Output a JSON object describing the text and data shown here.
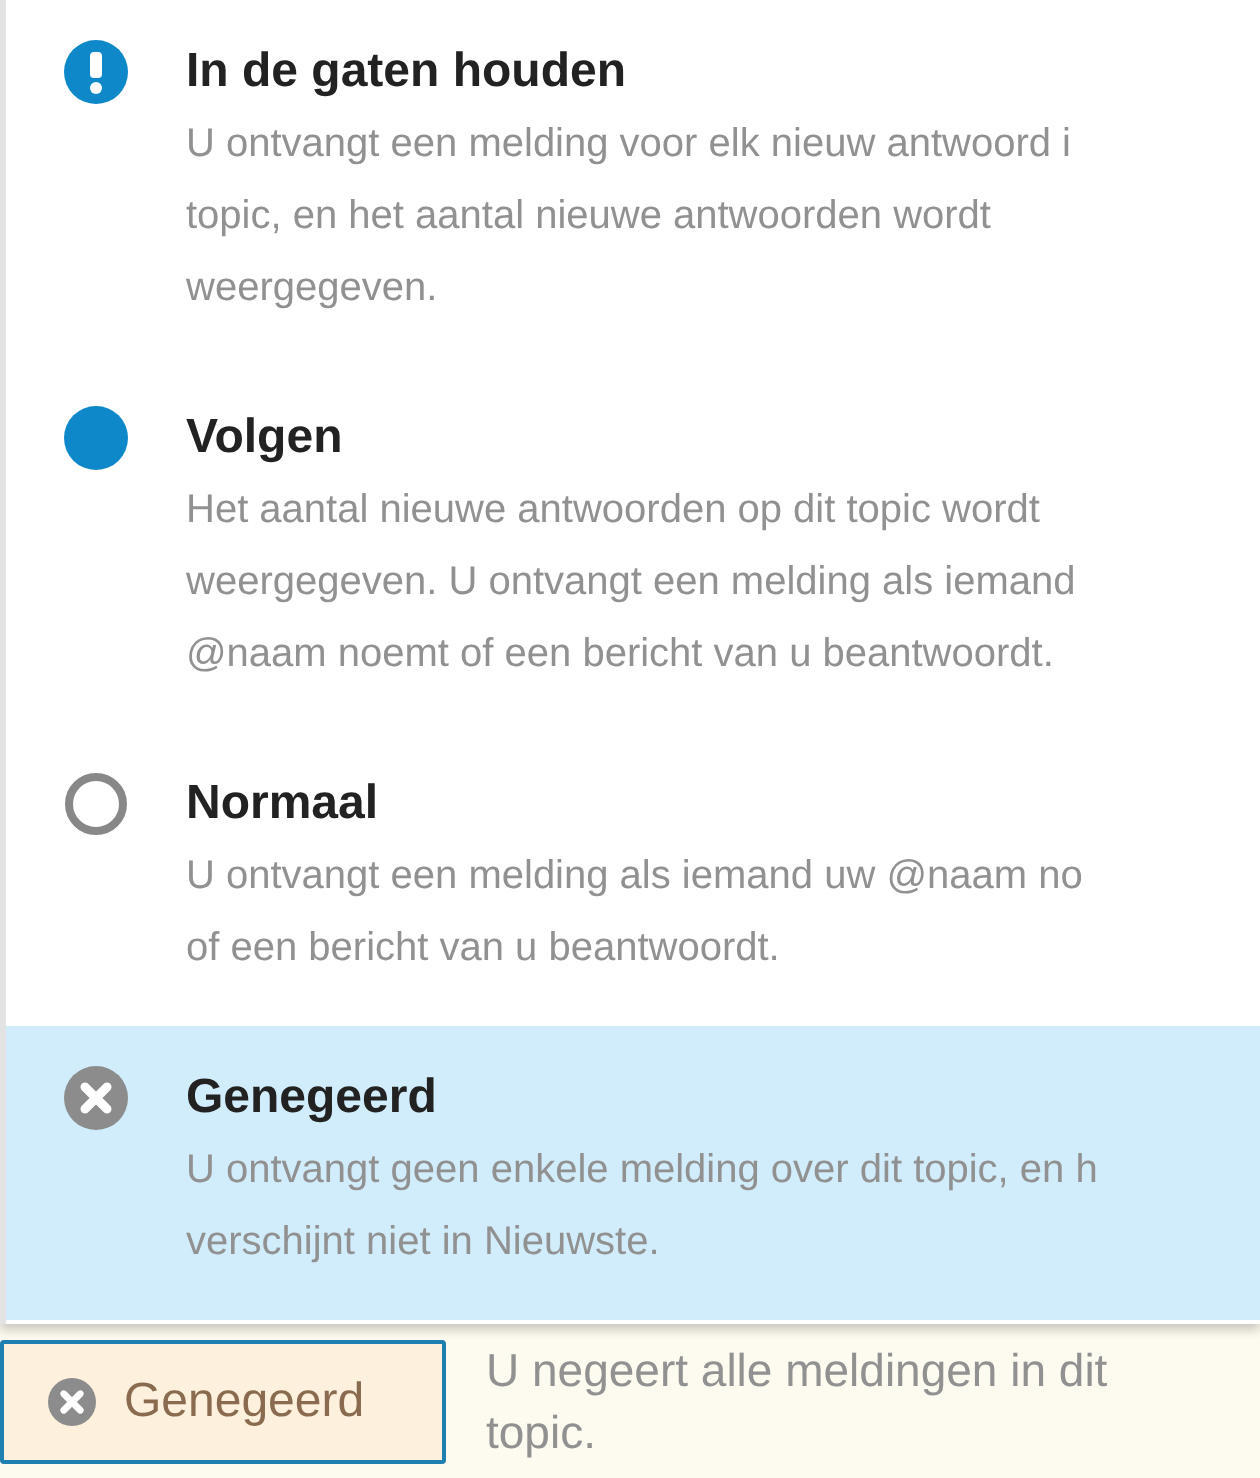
{
  "options": [
    {
      "kind": "alert",
      "title": "In de gaten houden",
      "description": [
        "U ontvangt een melding voor elk nieuw antwoord i",
        "topic, en het aantal nieuwe antwoorden wordt",
        "weergegeven."
      ],
      "selected": false
    },
    {
      "kind": "dot",
      "title": "Volgen",
      "description": [
        "Het aantal nieuwe antwoorden op dit topic wordt",
        "weergegeven. U ontvangt een melding als iemand",
        "@naam noemt of een bericht van u beantwoordt."
      ],
      "selected": false
    },
    {
      "kind": "ring",
      "title": "Normaal",
      "description": [
        "U ontvangt een melding als iemand uw @naam no",
        "of een bericht van u beantwoordt."
      ],
      "selected": false
    },
    {
      "kind": "muted",
      "title": "Genegeerd",
      "description": [
        "U ontvangt geen enkele melding over dit topic, en h",
        "verschijnt niet in Nieuwste."
      ],
      "selected": true
    }
  ],
  "footer": {
    "button": {
      "kind": "muted",
      "label": "Genegeerd"
    },
    "status": "U negeert alle meldingen in dit topic."
  }
}
